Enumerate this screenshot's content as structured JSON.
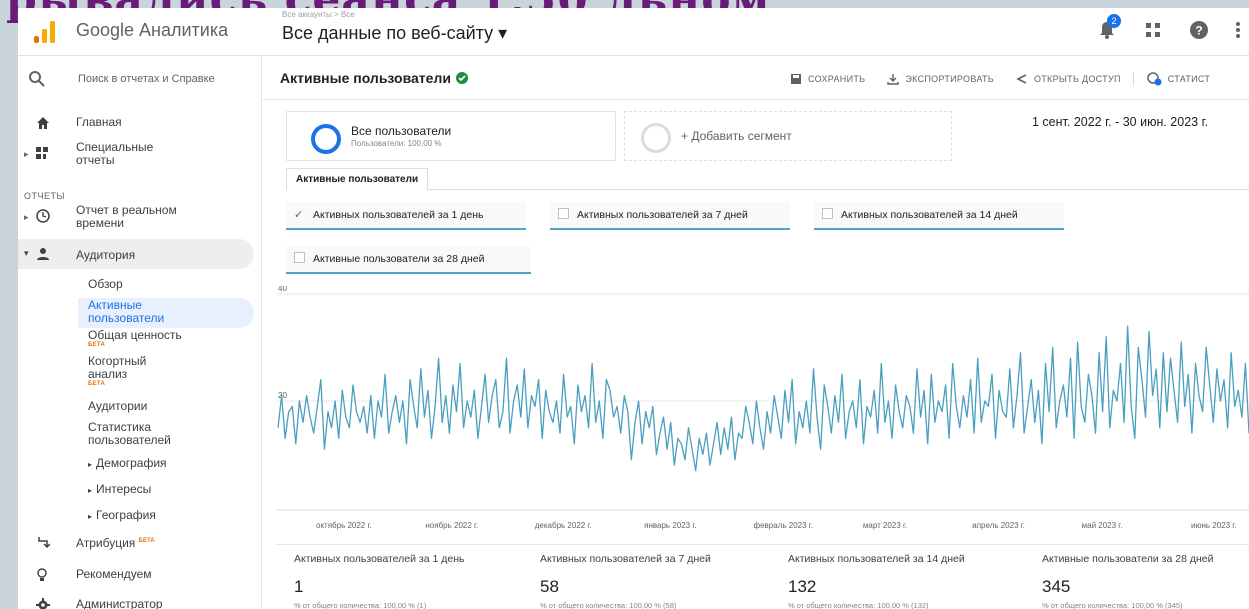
{
  "header": {
    "product_name": "Google Аналитика",
    "account_small": "Все аккаунты > Все",
    "account_select": "Все данные по веб-сайту ▾",
    "notification_count": "2"
  },
  "sidebar": {
    "search_placeholder": "Поиск в отчетах и Справке",
    "home": "Главная",
    "custom_reports": "Специальные отчеты",
    "section_reports": "ОТЧЕТЫ",
    "realtime": "Отчет в реальном времени",
    "audience": "Аудитория",
    "sub": {
      "overview": "Обзор",
      "active_users": "Активные пользователи",
      "lifetime_value": "Общая ценность",
      "cohort": "Когортный анализ",
      "audiences": "Аудитории",
      "user_explorer": "Статистика пользователей",
      "demographics": "Демография",
      "interests": "Интересы",
      "geo": "География"
    },
    "beta": "БЕТА",
    "attribution": "Атрибуция",
    "recommend": "Рекомендуем",
    "admin": "Администратор"
  },
  "main": {
    "title": "Активные пользователи",
    "actions": {
      "save": "СОХРАНИТЬ",
      "export": "ЭКСПОРТИРОВАТЬ",
      "share": "ОТКРЫТЬ ДОСТУП",
      "insights": "СТАТИСТ"
    },
    "segment": {
      "name": "Все пользователи",
      "sub": "Пользователи: 100,00 %"
    },
    "add_segment": "+ Добавить сегмент",
    "date_range": "1 сент. 2022 г. - 30 июн. 2023 г.",
    "tab": "Активные пользователи",
    "metrics": {
      "m1": "Активных пользователей за 1 день",
      "m7": "Активных пользователей за 7 дней",
      "m14": "Активных пользователей за 14 дней",
      "m28": "Активные пользователи за 28 дней"
    },
    "summary": [
      {
        "label": "Активных пользователей за 1 день",
        "value": "1",
        "sub": "% от общего количества: 100,00 % (1)"
      },
      {
        "label": "Активных пользователей за 7 дней",
        "value": "58",
        "sub": "% от общего количества: 100,00 % (58)"
      },
      {
        "label": "Активных пользователей за 14 дней",
        "value": "132",
        "sub": "% от общего количества: 100,00 % (132)"
      },
      {
        "label": "Активные пользователи за 28 дней",
        "value": "345",
        "sub": "% от общего количества: 100,00 % (345)"
      }
    ]
  },
  "colors": {
    "series": "#4a9fbf",
    "accent": "#1a73e8",
    "brand_orange": "#f9ab00",
    "verified": "#1e8e3e"
  },
  "chart_data": {
    "type": "line",
    "title": "",
    "xlabel": "",
    "ylabel": "",
    "y_ticks": [
      "20",
      "40"
    ],
    "ylim": [
      0,
      40
    ],
    "x_tick_labels": [
      "октябрь 2022 г.",
      "ноябрь 2022 г.",
      "декабрь 2022 г.",
      "январь 2023 г.",
      "февраль 2023 г.",
      "март 2023 г.",
      "апрель 2023 г.",
      "май 2023 г.",
      "июнь 2023 г."
    ],
    "series": [
      {
        "values": [
          15,
          21,
          13,
          18,
          19,
          12,
          20,
          16,
          21,
          17,
          14,
          19,
          24,
          11,
          18,
          15,
          20,
          13,
          22,
          17,
          15,
          23,
          18,
          16,
          19,
          14,
          21,
          13,
          20,
          17,
          25,
          14,
          18,
          21,
          16,
          20,
          12,
          24,
          19,
          15,
          26,
          17,
          22,
          13,
          19,
          28,
          16,
          21,
          14,
          23,
          18,
          27,
          15,
          20,
          17,
          22,
          13,
          19,
          25,
          16,
          21,
          24,
          15,
          18,
          28,
          14,
          20,
          23,
          17,
          26,
          15,
          21,
          19,
          24,
          13,
          22,
          18,
          16,
          20,
          14,
          25,
          17,
          19,
          12,
          23,
          18,
          21,
          15,
          27,
          16,
          20,
          13,
          24,
          22,
          17,
          19,
          14,
          21,
          18,
          9,
          16,
          20,
          12,
          18,
          15,
          19,
          10,
          14,
          17,
          11,
          16,
          8,
          13,
          12,
          9,
          15,
          11,
          7,
          13,
          10,
          14,
          8,
          12,
          16,
          10,
          15,
          11,
          17,
          9,
          14,
          13,
          19,
          16,
          12,
          20,
          15,
          11,
          18,
          14,
          21,
          17,
          13,
          22,
          16,
          24,
          12,
          18,
          15,
          20,
          14,
          26,
          17,
          11,
          23,
          19,
          14,
          21,
          16,
          25,
          13,
          18,
          20,
          15,
          24,
          12,
          19,
          17,
          22,
          14,
          27,
          16,
          20,
          13,
          23,
          18,
          15,
          21,
          19,
          14,
          26,
          17,
          22,
          12,
          25,
          16,
          20,
          18,
          23,
          13,
          27,
          19,
          15,
          21,
          17,
          24,
          14,
          28,
          16,
          20,
          19,
          25,
          13,
          22,
          18,
          17,
          26,
          15,
          21,
          29,
          14,
          19,
          24,
          16,
          22,
          12,
          27,
          18,
          30,
          15,
          20,
          23,
          17,
          28,
          13,
          31,
          19,
          16,
          25,
          21,
          14,
          29,
          18,
          32,
          15,
          22,
          20,
          27,
          16,
          34,
          19,
          13,
          30,
          24,
          17,
          33,
          21,
          26,
          15,
          29,
          18,
          28,
          22,
          16,
          31,
          19,
          25,
          14,
          27,
          21,
          18,
          30,
          23,
          16,
          26,
          20,
          24,
          15,
          29,
          19,
          22,
          17,
          27,
          14
        ]
      }
    ]
  }
}
